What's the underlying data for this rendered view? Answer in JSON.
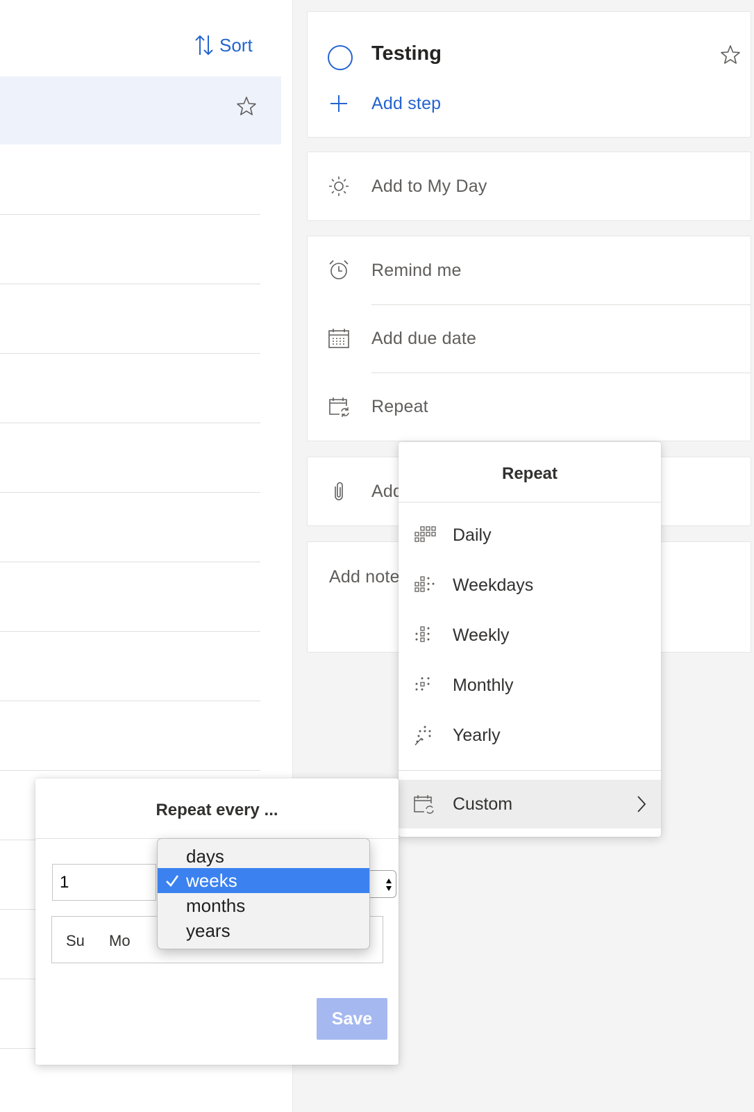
{
  "list": {
    "sort_label": "Sort"
  },
  "task": {
    "title": "Testing",
    "add_step_label": "Add step"
  },
  "detail": {
    "my_day_label": "Add to My Day",
    "remind_label": "Remind me",
    "due_date_label": "Add due date",
    "repeat_label": "Repeat",
    "attach_label": "Add",
    "note_placeholder": "Add note"
  },
  "repeat_menu": {
    "title": "Repeat",
    "items": [
      {
        "label": "Daily",
        "icon": "daily-icon"
      },
      {
        "label": "Weekdays",
        "icon": "weekdays-icon"
      },
      {
        "label": "Weekly",
        "icon": "weekly-icon"
      },
      {
        "label": "Monthly",
        "icon": "monthly-icon"
      },
      {
        "label": "Yearly",
        "icon": "yearly-icon"
      }
    ],
    "custom_label": "Custom"
  },
  "custom_dialog": {
    "title": "Repeat every ...",
    "interval_value": "1",
    "unit_options": [
      "days",
      "weeks",
      "months",
      "years"
    ],
    "selected_unit": "weeks",
    "days": [
      "Su",
      "Mo"
    ],
    "save_label": "Save"
  },
  "colors": {
    "accent": "#2564cf",
    "selected_row": "#eef2fb",
    "save_disabled": "#a5b8f0",
    "select_highlight": "#3b82f0"
  }
}
